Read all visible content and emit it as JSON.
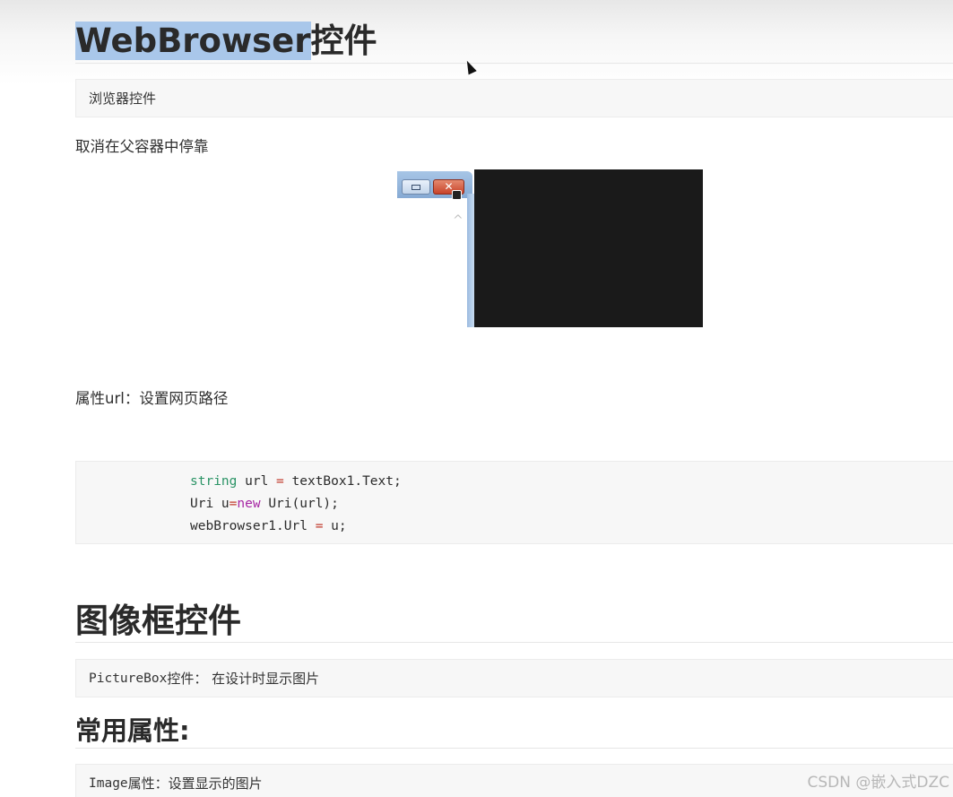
{
  "section1": {
    "title_selected": "WebBrowser",
    "title_rest": "控件",
    "quote": "浏览器控件",
    "undock_text": "取消在父容器中停靠",
    "property_url_text": "属性url：设置网页路径"
  },
  "embedded_window": {
    "close_glyph": "✕",
    "scroll_up_glyph": "^"
  },
  "code_block": {
    "line1": {
      "kw": "string",
      "mid": " url ",
      "op": "=",
      "rest": " textBox1.Text;"
    },
    "line2": {
      "pre": "Uri u",
      "op": "=",
      "kw": "new",
      "rest": " Uri(url);"
    },
    "line3": {
      "pre": "webBrowser1.Url ",
      "op": "=",
      "rest": " u;"
    }
  },
  "section2": {
    "title": "图像框控件",
    "quote_mono": "PictureBox",
    "quote_rest": "控件：  在设计时显示图片"
  },
  "section3": {
    "title": "常用属性:",
    "quote_mono": "Image",
    "quote_rest": " 属性：设置显示的图片"
  },
  "watermark": "CSDN @嵌入式DZC"
}
